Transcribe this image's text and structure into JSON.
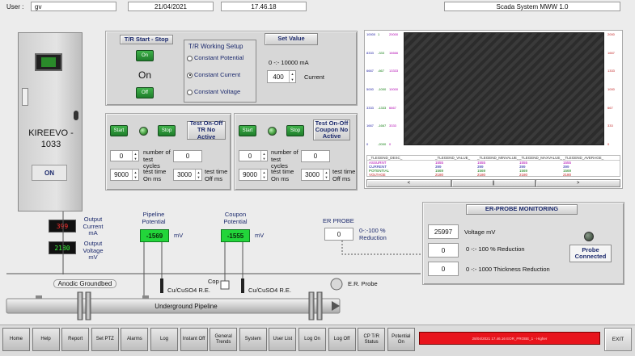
{
  "header": {
    "user_label": "User :",
    "user_value": "gv",
    "date": "21/04/2021",
    "time": "17.46.18",
    "system_title": "Scada System MWW 1.0"
  },
  "cabinet": {
    "name": "KIREEVO - 1033",
    "state": "ON"
  },
  "tr_start_stop": {
    "title": "T/R Start - Stop",
    "on_button": "On",
    "off_button": "Off",
    "status": "On"
  },
  "working_setup": {
    "title": "T/R Working Setup",
    "options": [
      {
        "label": "Constant Potential",
        "selected": false
      },
      {
        "label": "Constant Current",
        "selected": true
      },
      {
        "label": "Constant Voltage",
        "selected": false
      }
    ]
  },
  "set_value": {
    "title": "Set Value",
    "range": "0 -:- 10000 mA",
    "value": "400",
    "unit_label": "Current"
  },
  "tr_cycle": {
    "start": "Start",
    "stop": "Stop",
    "status": "Test On-Off TR No Active",
    "cycles_value": "0",
    "cycles_label": "number of test cycles",
    "cycles_count": "0",
    "on_ms": "9000",
    "on_label": "test time On ms",
    "off_ms": "3000",
    "off_label": "test time Off ms"
  },
  "coupon_cycle": {
    "start": "Start",
    "stop": "Stop",
    "status": "Test On-Off Coupon No Active",
    "cycles_value": "0",
    "cycles_label": "number of test cycles",
    "cycles_count": "0",
    "on_ms": "9000",
    "on_label": "test time On ms",
    "off_ms": "3000",
    "off_label": "test time Off ms"
  },
  "trend": {
    "left_ticks": [
      [
        "10000",
        "1",
        "20000"
      ],
      [
        "8333",
        "-333",
        "16666"
      ],
      [
        "6667",
        "-667",
        "13333"
      ],
      [
        "5000",
        "-1000",
        "10000"
      ],
      [
        "3333",
        "-1333",
        "6667"
      ],
      [
        "1667",
        "-1667",
        "3333"
      ],
      [
        "0",
        "-2000",
        "0"
      ]
    ],
    "right_ticks": [
      "2000",
      "1667",
      "1333",
      "1000",
      "667",
      "333",
      "0"
    ],
    "legend_headers": [
      "_TLEGEND_DESC_",
      "_TLEGEND_VALUE_",
      "_TLEGEND_MINVALUE_",
      "_TLEGEND_MAXVALUE_",
      "_TLEGEND_AVERAGE_"
    ],
    "legend_rows": [
      {
        "name": "ASSURNT",
        "value": "1555",
        "min": "1555",
        "max": "1555",
        "avg": "1555",
        "color": "#b000b0"
      },
      {
        "name": "CURRENT",
        "value": "399",
        "min": "399",
        "max": "399",
        "avg": "399",
        "color": "#1a1aa0"
      },
      {
        "name": "POTENTIAL",
        "value": "1569",
        "min": "1569",
        "max": "1569",
        "avg": "1569",
        "color": "#0a7a0a"
      },
      {
        "name": "VOLTAGE",
        "value": "2180",
        "min": "2180",
        "max": "2180",
        "avg": "2180",
        "color": "#c02020"
      }
    ],
    "nav": [
      "<",
      "||",
      ">"
    ]
  },
  "output": {
    "current_value": "399",
    "current_label": "Output Current mA",
    "voltage_value": "2180",
    "voltage_label": "Output Voltage mV"
  },
  "pipeline_potential": {
    "label": "Pipeline Potential",
    "value": "-1569",
    "unit": "mV"
  },
  "coupon_potential": {
    "label": "Coupon Potential",
    "value": "-1555",
    "unit": "mV"
  },
  "er_probe_reading": {
    "label": "ER PROBE",
    "value": "0",
    "range": "0-:-100 % Reduction"
  },
  "er_monitoring": {
    "title": "ER-PROBE MONITORING",
    "voltage_value": "25997",
    "voltage_label": "Voltage mV",
    "reduction_value": "0",
    "reduction_label": "0 -:- 100 % Reduction",
    "thickness_value": "0",
    "thickness_label": "0 -:- 1000 Thickness Reduction",
    "probe_status": "Probe Connected"
  },
  "schematic": {
    "anodic": "Anodic Groundbed",
    "re1": "Cu/CuSO4 R.E.",
    "cop": "Cop",
    "re2": "Cu/CuSO4 R.E.",
    "er_probe": "E.R. Probe",
    "pipeline": "Underground Pipeline"
  },
  "toolbar": {
    "buttons": [
      "Home",
      "Help",
      "Report",
      "Set PTZ",
      "Alarms",
      "Log",
      "Instant Off",
      "General Trends",
      "System",
      "User List",
      "Log On",
      "Log Off",
      "CP T/R Status",
      "Potential On"
    ],
    "exit": "EXIT"
  },
  "alarm_bar": {
    "text": "28/04/2021 17.46.16 EOR_PROBE_1 - Higher",
    "color": "#e8141c"
  }
}
